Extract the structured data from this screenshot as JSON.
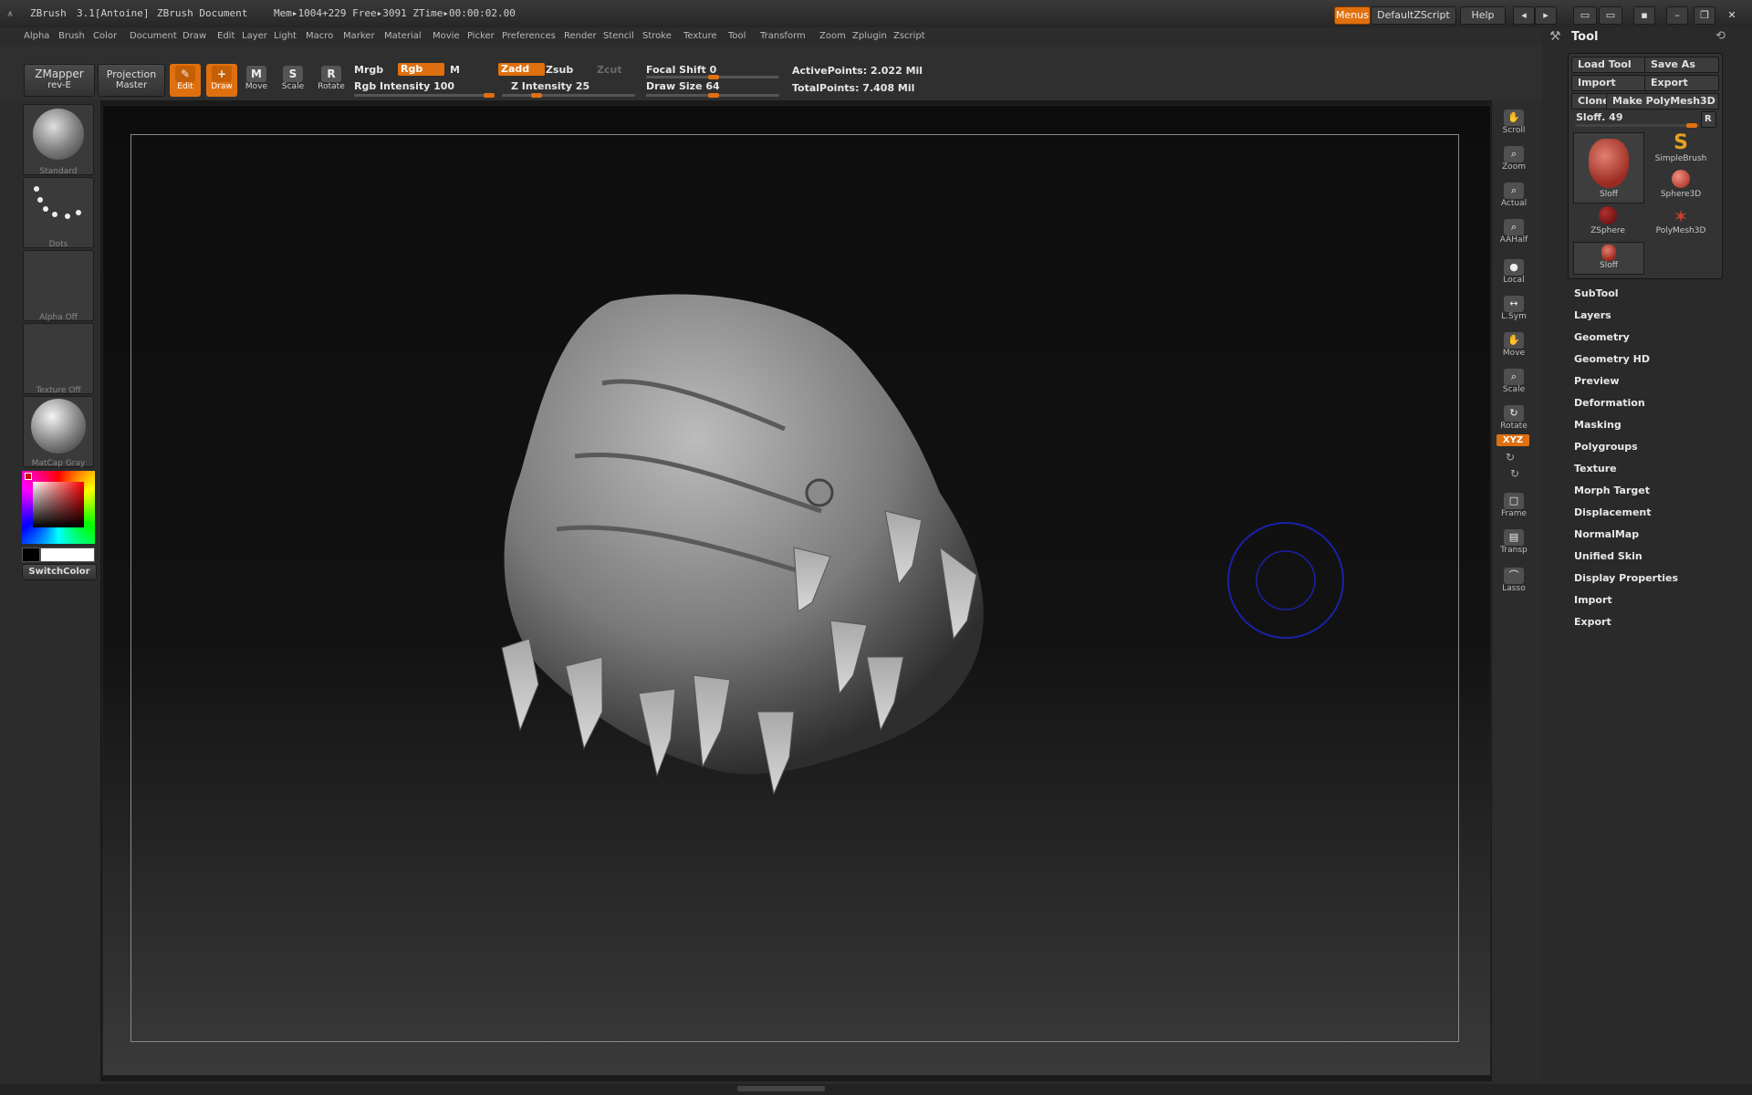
{
  "titlebar": {
    "app": "ZBrush",
    "version": "3.1[Antoine]",
    "document": "ZBrush Document",
    "mem": "Mem▸1004+229 Free▸3091 ZTime▸00:00:02.00",
    "menus_btn": "Menus",
    "script_btn": "DefaultZScript",
    "help_btn": "Help"
  },
  "menubar": [
    "Alpha",
    "Brush",
    "Color",
    "Document",
    "Draw",
    "Edit",
    "Layer",
    "Light",
    "Macro",
    "Marker",
    "Material",
    "Movie",
    "Picker",
    "Preferences",
    "Render",
    "Stencil",
    "Stroke",
    "Texture",
    "Tool",
    "Transform",
    "Zoom",
    "Zplugin",
    "Zscript"
  ],
  "shelf": {
    "zmapper": "ZMapper",
    "zmapper_sub": "rev-E",
    "projection": "Projection",
    "projection_sub": "Master",
    "tools": [
      {
        "glyph": "✎",
        "label": "Edit"
      },
      {
        "glyph": "+",
        "label": "Draw"
      },
      {
        "glyph": "M",
        "label": "Move"
      },
      {
        "glyph": "S",
        "label": "Scale"
      },
      {
        "glyph": "R",
        "label": "Rotate"
      }
    ],
    "mrgb": "Mrgb",
    "rgb": "Rgb",
    "m": "M",
    "rgb_intensity": "Rgb Intensity 100",
    "zadd": "Zadd",
    "zsub": "Zsub",
    "zcut": "Zcut",
    "z_intensity": "Z Intensity 25",
    "focal_shift": "Focal Shift 0",
    "draw_size": "Draw Size 64",
    "active_points": "ActivePoints: 2.022 Mil",
    "total_points": "TotalPoints: 7.408 Mil"
  },
  "leftshelf": {
    "brush": "Standard",
    "stroke": "Dots",
    "alpha": "Alpha Off",
    "texture": "Texture Off",
    "material": "MatCap Gray",
    "switchcolor": "SwitchColor"
  },
  "rightstrip": [
    {
      "glyph": "✋",
      "label": "Scroll"
    },
    {
      "glyph": "⌕",
      "label": "Zoom"
    },
    {
      "glyph": "⌕",
      "label": "Actual"
    },
    {
      "glyph": "⌕",
      "label": "AAHalf"
    },
    {
      "glyph": "●",
      "label": "Local"
    },
    {
      "glyph": "↔",
      "label": "L.Sym"
    },
    {
      "glyph": "✋",
      "label": "Move"
    },
    {
      "glyph": "⌕",
      "label": "Scale"
    },
    {
      "glyph": "↻",
      "label": "Rotate"
    },
    {
      "glyph": "□",
      "label": "Frame"
    },
    {
      "glyph": "▤",
      "label": "Transp"
    },
    {
      "glyph": "⌒",
      "label": "Lasso"
    }
  ],
  "xyz": "XYZ",
  "tool_panel": {
    "title": "Tool",
    "load_tool": "Load Tool",
    "save_as": "Save As",
    "import": "Import",
    "export": "Export",
    "clone": "Clone",
    "make_polymesh": "Make PolyMesh3D",
    "sloff": "Sloff. 49",
    "r": "R",
    "thumbs": [
      "Sloff",
      "SimpleBrush",
      "Sphere3D",
      "ZSphere",
      "PolyMesh3D",
      "Sloff"
    ],
    "sections": [
      "SubTool",
      "Layers",
      "Geometry",
      "Geometry HD",
      "Preview",
      "Deformation",
      "Masking",
      "Polygroups",
      "Texture",
      "Morph Target",
      "Displacement",
      "NormalMap",
      "Unified Skin",
      "Display Properties",
      "Import",
      "Export"
    ]
  },
  "colors": {
    "accent": "#e0700f",
    "cursor_ring": "#1a22a8"
  }
}
